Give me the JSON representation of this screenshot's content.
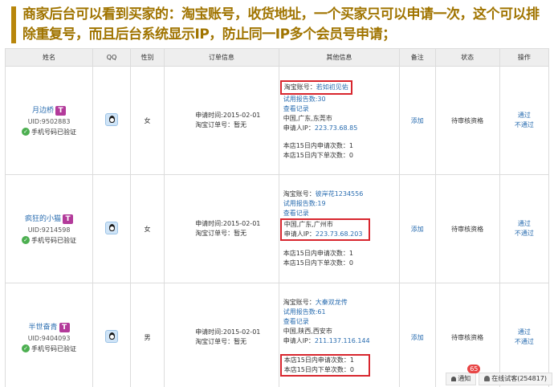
{
  "banner": {
    "text": "商家后台可以看到买家的：淘宝账号，收货地址，一个买家只可以申请一次，这个可以排除重复号，而且后台系统显示IP，防止同一IP多个会员号申请；"
  },
  "table": {
    "headers": [
      "姓名",
      "QQ",
      "性别",
      "订单信息",
      "其他信息",
      "备注",
      "状态",
      "操作"
    ],
    "rows": [
      {
        "name": "月边桥",
        "badge": "T",
        "uid": "UID:9502883",
        "verified": "手机号码已验证",
        "gender": "女",
        "apply_time": "申请时间:2015-02-01",
        "order_no": "淘宝订单号：暂无",
        "taobao": "淘宝账号：",
        "taobao_value": "若如初见佑",
        "reports": "试用报告数:30",
        "view": "查看记录",
        "region": "中国,广东,东莞市",
        "ip_label": "申请人IP：",
        "ip": "223.73.68.85",
        "apply_count": "本店15日内申请次数：1",
        "order_count": "本店15日内下单次数：0",
        "note": "添加",
        "status": "待审核资格",
        "pass": "通过",
        "reject": "不通过"
      },
      {
        "name": "疯狂的小猫",
        "badge": "T",
        "uid": "UID:9214598",
        "verified": "手机号码已验证",
        "gender": "女",
        "apply_time": "申请时间:2015-02-01",
        "order_no": "淘宝订单号：暂无",
        "taobao": "淘宝账号：",
        "taobao_value": "彼岸花1234556",
        "reports": "试用报告数:19",
        "view": "查看记录",
        "region": "中国,广东,广州市",
        "ip_label": "申请人IP：",
        "ip": "223.73.68.203",
        "apply_count": "本店15日内申请次数：1",
        "order_count": "本店15日内下单次数：0",
        "note": "添加",
        "status": "待审核资格",
        "pass": "通过",
        "reject": "不通过"
      },
      {
        "name": "半世奋青",
        "badge": "T",
        "uid": "UID:9404093",
        "verified": "手机号码已验证",
        "gender": "男",
        "apply_time": "申请时间:2015-02-01",
        "order_no": "淘宝订单号：暂无",
        "taobao": "淘宝账号：",
        "taobao_value": "大秦双龙传",
        "reports": "试用报告数:61",
        "view": "查看记录",
        "region": "中国,陕西,西安市",
        "ip_label": "申请人IP：",
        "ip": "211.137.116.144",
        "apply_count": "本店15日内申请次数：1",
        "order_count": "本店15日内下单次数：0",
        "note": "添加",
        "status": "待审核资格",
        "pass": "通过",
        "reject": "不通过"
      }
    ]
  },
  "footer": {
    "notify_label": "通知",
    "notify_count": "65",
    "online_label": "在线试客(254817)"
  },
  "colors": {
    "banner_text": "#a07400",
    "link": "#2a6db0",
    "highlight_box": "#d8262e",
    "badge": "#b33a9a"
  }
}
